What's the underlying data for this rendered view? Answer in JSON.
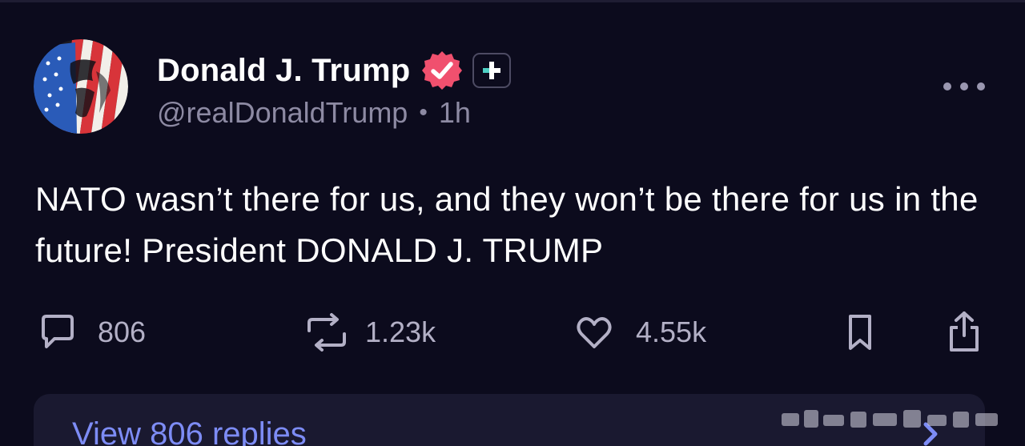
{
  "post": {
    "display_name": "Donald J. Trump",
    "handle": "@realDonaldTrump",
    "separator": "•",
    "time_ago": "1h",
    "text": "NATO wasn’t there for us, and they won’t be there for us in the future! President DONALD J. TRUMP"
  },
  "actions": {
    "replies_count": "806",
    "retruths_count": "1.23k",
    "likes_count": "4.55k"
  },
  "replies_link": {
    "label": "View 806 replies"
  },
  "icons": {
    "verified": "verified-badge-icon",
    "plus": "plus-badge-icon",
    "more": "more-icon",
    "reply": "comment-icon",
    "retruth": "repost-icon",
    "like": "heart-icon",
    "bookmark": "bookmark-icon",
    "share": "share-icon",
    "chevron": "chevron-right-icon"
  },
  "colors": {
    "background": "#0c0b1d",
    "verified": "#f0506e",
    "plus_accent": "#4ed0c4",
    "link": "#7d8cf5",
    "muted": "#8d8aa3"
  }
}
